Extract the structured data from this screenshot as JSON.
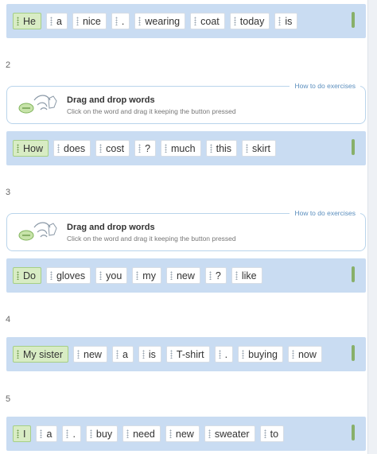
{
  "exercises": [
    {
      "number": "",
      "words": [
        "He",
        "a",
        "nice",
        ".",
        "wearing",
        "coat",
        "today",
        "is"
      ]
    },
    {
      "number": "2",
      "words": [
        "How",
        "does",
        "cost",
        "?",
        "much",
        "this",
        "skirt"
      ],
      "instruction": {
        "title": "Drag and drop words",
        "subtitle": "Click on the word and drag it keeping the button pressed",
        "help_link": "How to do exercises"
      }
    },
    {
      "number": "3",
      "words": [
        "Do",
        "gloves",
        "you",
        "my",
        "new",
        "?",
        "like"
      ],
      "instruction": {
        "title": "Drag and drop words",
        "subtitle": "Click on the word and drag it keeping the button pressed",
        "help_link": "How to do exercises"
      }
    },
    {
      "number": "4",
      "words": [
        "My sister",
        "new",
        "a",
        "is",
        "T-shirt",
        ".",
        "buying",
        "now"
      ]
    },
    {
      "number": "5",
      "words": [
        "I",
        "a",
        ".",
        "buy",
        "need",
        "new",
        "sweater",
        "to"
      ]
    }
  ],
  "icons": {
    "instruction_icon": "drag-hand-icon",
    "check_mark": "green-bar-indicator"
  },
  "colors": {
    "bar": "#c9dcf2",
    "first_chip": "#d8ecc4",
    "instruction_border": "#b9d4eb",
    "help_link": "#5c8fbe"
  }
}
